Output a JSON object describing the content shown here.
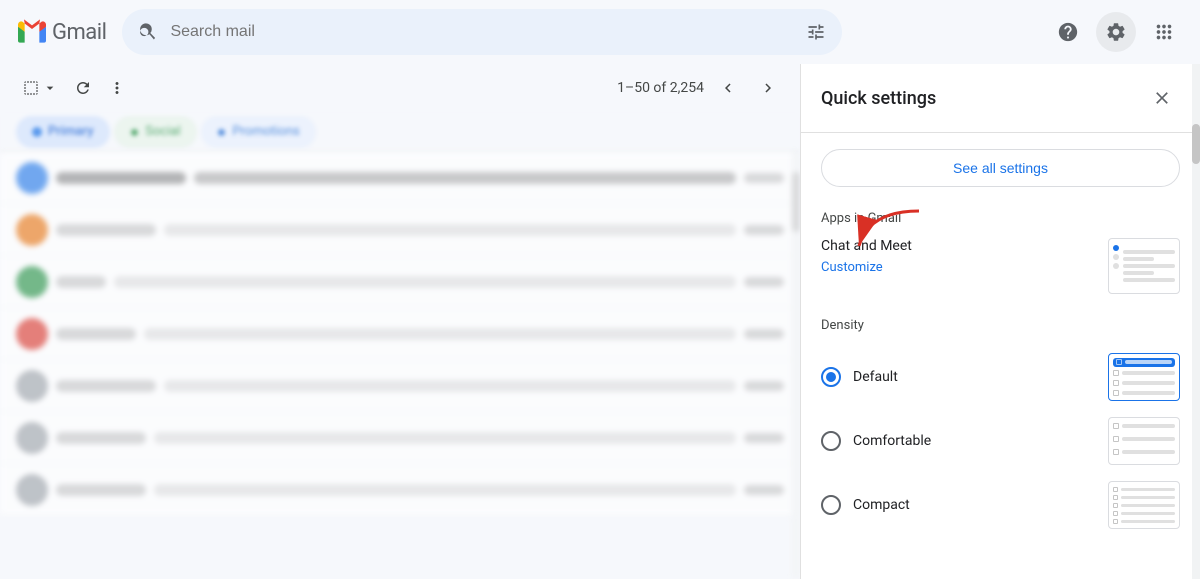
{
  "topbar": {
    "app_name": "Gmail",
    "search_placeholder": "Search mail",
    "help_label": "Help",
    "settings_label": "Settings",
    "apps_label": "Google apps"
  },
  "toolbar": {
    "pagination_text": "1–50 of 2,254",
    "select_label": "Select",
    "more_label": "More"
  },
  "quick_settings": {
    "title": "Quick settings",
    "close_label": "Close",
    "see_all_label": "See all settings",
    "apps_section_label": "Apps in Gmail",
    "chat_meet_title": "Chat and Meet",
    "customize_label": "Customize",
    "density_section_label": "Density",
    "density_options": [
      {
        "id": "default",
        "label": "Default",
        "selected": true
      },
      {
        "id": "comfortable",
        "label": "Comfortable",
        "selected": false
      },
      {
        "id": "compact",
        "label": "Compact",
        "selected": false
      }
    ]
  },
  "email_rows": [
    {
      "sender_width": 120,
      "avatar_color": "#1a73e8",
      "unread": true
    },
    {
      "sender_width": 100,
      "avatar_color": "#e8710a",
      "unread": false
    },
    {
      "sender_width": 50,
      "avatar_color": "#1e8e3e",
      "unread": false
    },
    {
      "sender_width": 80,
      "avatar_color": "#d93025",
      "unread": false
    },
    {
      "sender_width": 100,
      "avatar_color": "#9aa0a6",
      "unread": false
    },
    {
      "sender_width": 90,
      "avatar_color": "#9aa0a6",
      "unread": false
    },
    {
      "sender_width": 90,
      "avatar_color": "#9aa0a6",
      "unread": false
    }
  ]
}
